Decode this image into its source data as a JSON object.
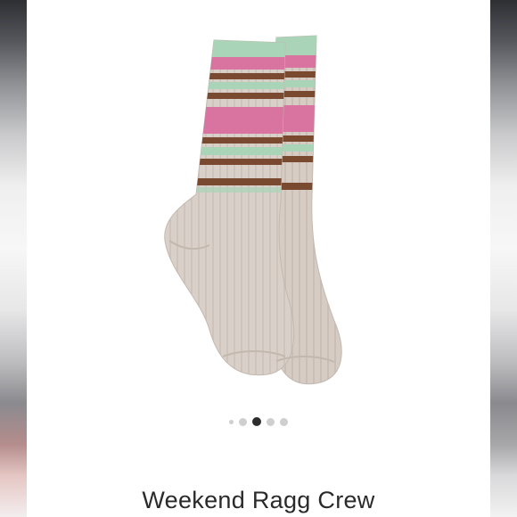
{
  "product": {
    "title": "Weekend Ragg Crew",
    "image_icon": "striped-crew-socks",
    "colors": {
      "base": "#d9d0c9",
      "pink": "#d9739f",
      "mint": "#a9d4b8",
      "brown": "#7a4a30"
    }
  },
  "carousel": {
    "slide_count": 5,
    "active_index": 2
  }
}
